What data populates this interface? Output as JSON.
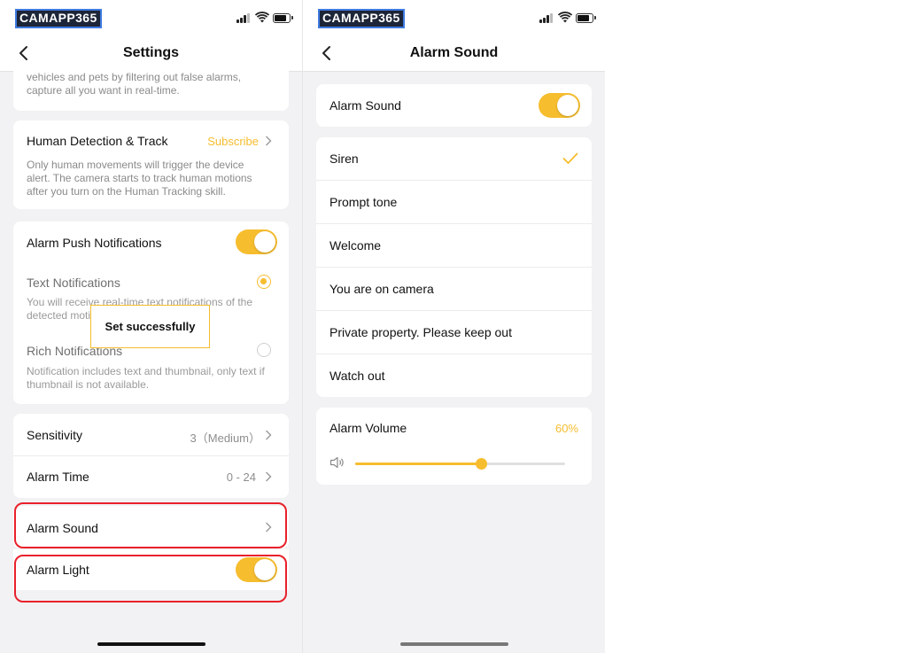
{
  "brand": {
    "logo_text": "CAMAPP365"
  },
  "colors": {
    "accent": "#f6bd2e",
    "highlight": "#e8212b"
  },
  "left": {
    "nav": {
      "title": "Settings",
      "back_icon": "chevron-left-icon"
    },
    "top_card": {
      "desc": "vehicles and pets by filtering out false alarms, capture all you want in real-time."
    },
    "human_detection": {
      "title": "Human Detection & Track",
      "action": "Subscribe",
      "desc": "Only human movements will trigger the device alert. The camera starts to track human motions after you turn on the Human Tracking skill."
    },
    "push": {
      "title": "Alarm Push Notifications",
      "toggle_on": true,
      "text_notif": {
        "title": "Text Notifications",
        "desc": "You will receive real-time text notifications of the detected motions.",
        "selected": true
      },
      "rich_notif": {
        "title": "Rich Notifications",
        "desc": "Notification includes text and thumbnail, only text if thumbnail is not available.",
        "selected": false
      }
    },
    "toast": "Set successfully",
    "sensitivity": {
      "title": "Sensitivity",
      "value": "3（Medium）"
    },
    "alarm_time": {
      "title": "Alarm Time",
      "value": "0 - 24"
    },
    "alarm_sound": {
      "title": "Alarm Sound"
    },
    "alarm_light": {
      "title": "Alarm Light",
      "toggle_on": true
    }
  },
  "right": {
    "nav": {
      "title": "Alarm Sound",
      "back_icon": "chevron-left-icon"
    },
    "alarm_sound_toggle": {
      "title": "Alarm Sound",
      "toggle_on": true
    },
    "sounds": [
      {
        "label": "Siren",
        "selected": true
      },
      {
        "label": "Prompt tone",
        "selected": false
      },
      {
        "label": "Welcome",
        "selected": false
      },
      {
        "label": "You are on camera",
        "selected": false
      },
      {
        "label": "Private property. Please keep out",
        "selected": false
      },
      {
        "label": "Watch out",
        "selected": false
      }
    ],
    "volume": {
      "title": "Alarm Volume",
      "value_text": "60%",
      "level": 0.6
    }
  }
}
